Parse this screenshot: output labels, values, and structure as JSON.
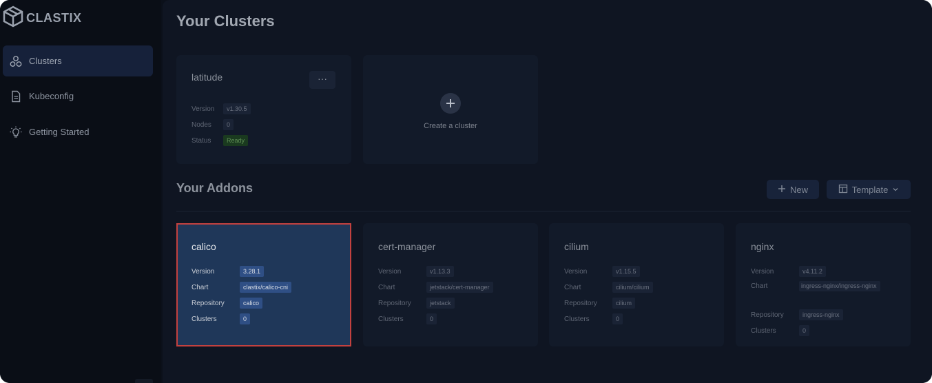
{
  "app": {
    "logo_text": "CLASTIX",
    "colors": {
      "accent": "#16213a",
      "selected_card": "#1f3759",
      "highlight_border": "#c3413f",
      "ready": "#1a3a1f"
    }
  },
  "sidebar": {
    "items": [
      {
        "label": "Clusters",
        "icon": "clusters-icon",
        "active": true
      },
      {
        "label": "Kubeconfig",
        "icon": "document-icon",
        "active": false
      },
      {
        "label": "Getting Started",
        "icon": "lightbulb-icon",
        "active": false
      }
    ]
  },
  "main": {
    "title": "Your Clusters",
    "addons_title": "Your Addons",
    "new_button": "New",
    "template_button": "Template",
    "clusters": [
      {
        "name": "latitude",
        "more": "···",
        "version_label": "Version",
        "version": "v1.30.5",
        "nodes_label": "Nodes",
        "nodes": "0",
        "status_label": "Status",
        "status": "Ready"
      }
    ],
    "create_cluster_label": "Create a cluster",
    "addons": [
      {
        "name": "calico",
        "version_label": "Version",
        "version": "3.28.1",
        "chart_label": "Chart",
        "chart": "clastix/calico-cni",
        "repository_label": "Repository",
        "repository": "calico",
        "clusters_label": "Clusters",
        "clusters": "0"
      },
      {
        "name": "cert-manager",
        "version_label": "Version",
        "version": "v1.13.3",
        "chart_label": "Chart",
        "chart": "jetstack/cert-manager",
        "repository_label": "Repository",
        "repository": "jetstack",
        "clusters_label": "Clusters",
        "clusters": "0"
      },
      {
        "name": "cilium",
        "version_label": "Version",
        "version": "v1.15.5",
        "chart_label": "Chart",
        "chart": "cilium/cilium",
        "repository_label": "Repository",
        "repository": "cilium",
        "clusters_label": "Clusters",
        "clusters": "0"
      },
      {
        "name": "nginx",
        "version_label": "Version",
        "version": "v4.11.2",
        "chart_label": "Chart",
        "chart": "ingress-nginx/ingress-nginx",
        "repository_label": "Repository",
        "repository": "ingress-nginx",
        "clusters_label": "Clusters",
        "clusters": "0"
      }
    ]
  }
}
